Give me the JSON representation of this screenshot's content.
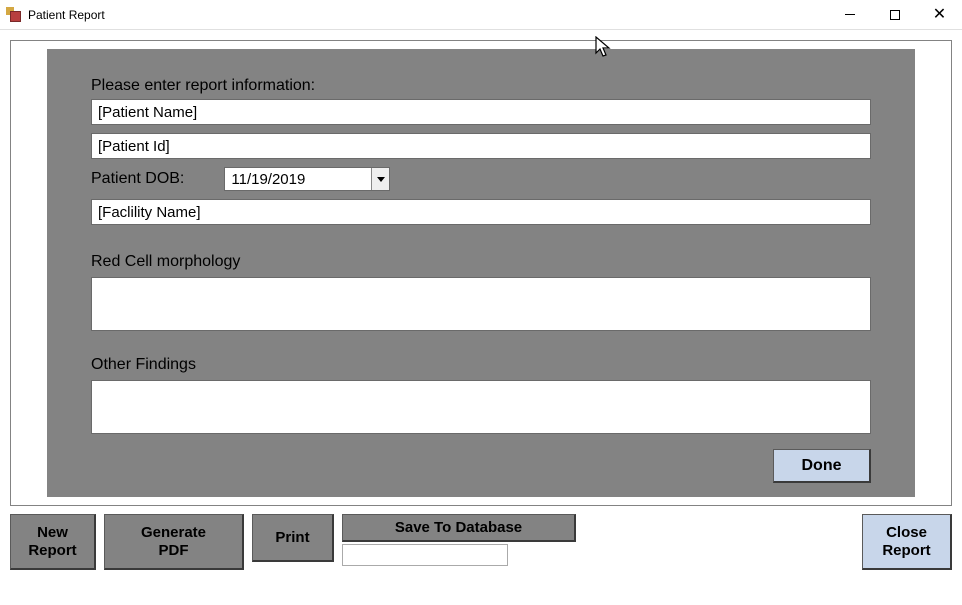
{
  "window": {
    "title": "Patient Report"
  },
  "form": {
    "prompt": "Please enter report information:",
    "patient_name": "[Patient Name]",
    "patient_id": "[Patient Id]",
    "dob_label": "Patient DOB:",
    "dob_value": "11/19/2019",
    "facility_name": "[Faclility Name]",
    "red_cell_label": "Red Cell morphology",
    "red_cell_value": "",
    "other_findings_label": "Other Findings",
    "other_findings_value": "",
    "done_label": "Done"
  },
  "toolbar": {
    "new_report": "New\nReport",
    "generate_pdf": "Generate\nPDF",
    "print": "Print",
    "save_db": "Save To Database",
    "close_report": "Close\nReport"
  }
}
